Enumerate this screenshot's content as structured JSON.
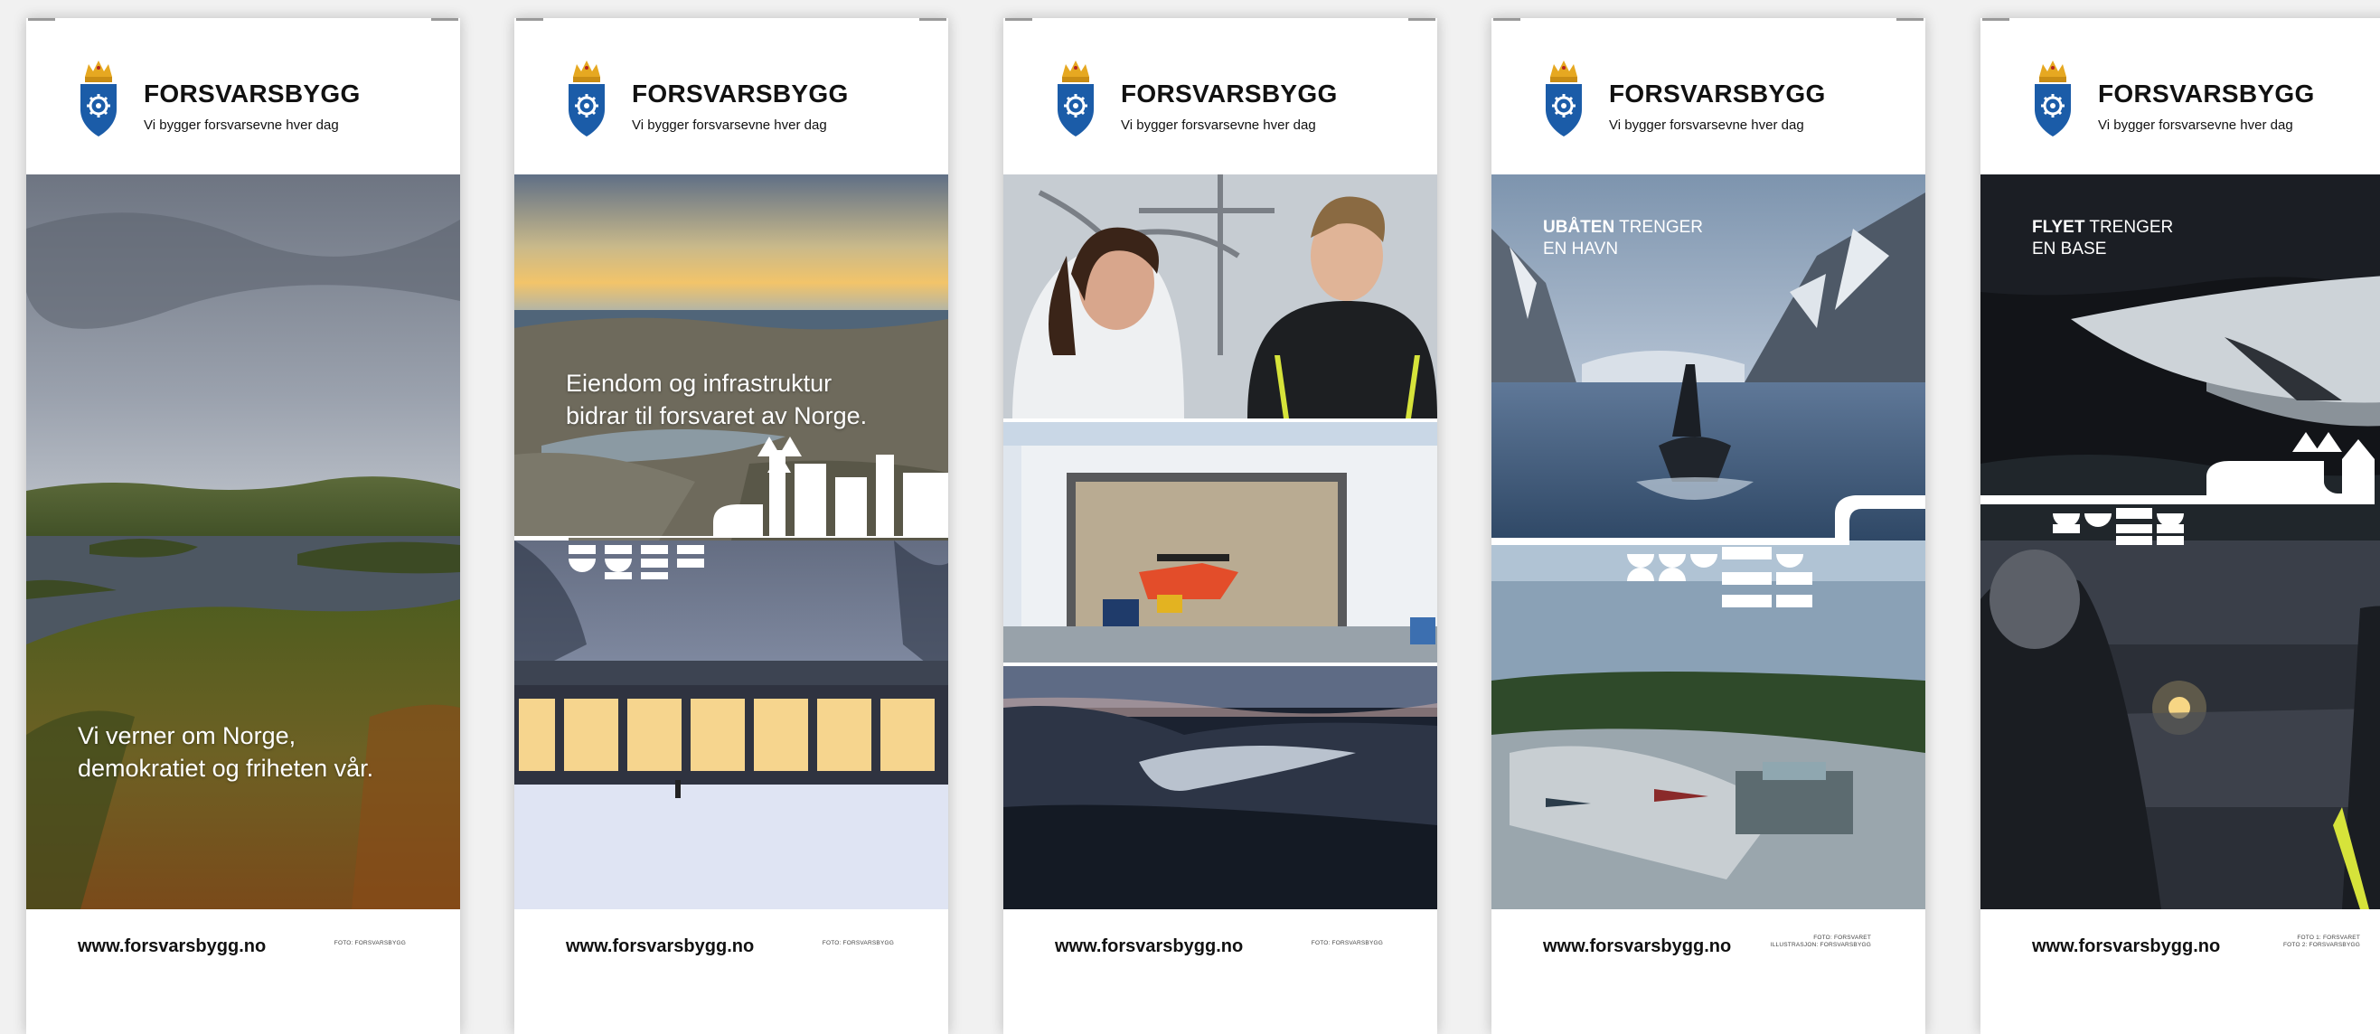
{
  "colors": {
    "crest_blue": "#1b5ca8",
    "crest_gold": "#e6a821",
    "crest_red": "#b5241f",
    "text": "#111111"
  },
  "banners": [
    {
      "brand": "FORSVARSBYGG",
      "tagline": "Vi bygger forsvarsevne hver dag",
      "overlay_line1": "Vi verner om Norge,",
      "overlay_line2": "demokratiet og friheten vår.",
      "url": "www.forsvarsbygg.no",
      "credit": "FOTO: FORSVARSBYGG"
    },
    {
      "brand": "FORSVARSBYGG",
      "tagline": "Vi bygger forsvarsevne hver dag",
      "overlay_line1": "Eiendom og infrastruktur",
      "overlay_line2": "bidrar til forsvaret av Norge.",
      "url": "www.forsvarsbygg.no",
      "credit": "FOTO: FORSVARSBYGG"
    },
    {
      "brand": "FORSVARSBYGG",
      "tagline": "Vi bygger forsvarsevne hver dag",
      "url": "www.forsvarsbygg.no",
      "credit": "FOTO: FORSVARSBYGG"
    },
    {
      "brand": "FORSVARSBYGG",
      "tagline": "Vi bygger forsvarsevne hver dag",
      "headline_bold": "UBÅTEN",
      "headline_rest": " TRENGER",
      "headline_line2": "EN HAVN",
      "url": "www.forsvarsbygg.no",
      "credit_line1": "FOTO: FORSVARET",
      "credit_line2": "ILLUSTRASJON: FORSVARSBYGG"
    },
    {
      "brand": "FORSVARSBYGG",
      "tagline": "Vi bygger forsvarsevne hver dag",
      "headline_bold": "FLYET",
      "headline_rest": " TRENGER",
      "headline_line2": "EN BASE",
      "url": "www.forsvarsbygg.no",
      "credit_line1": "FOTO 1: FORSVARET",
      "credit_line2": "FOTO 2: FORSVARSBYGG"
    }
  ]
}
